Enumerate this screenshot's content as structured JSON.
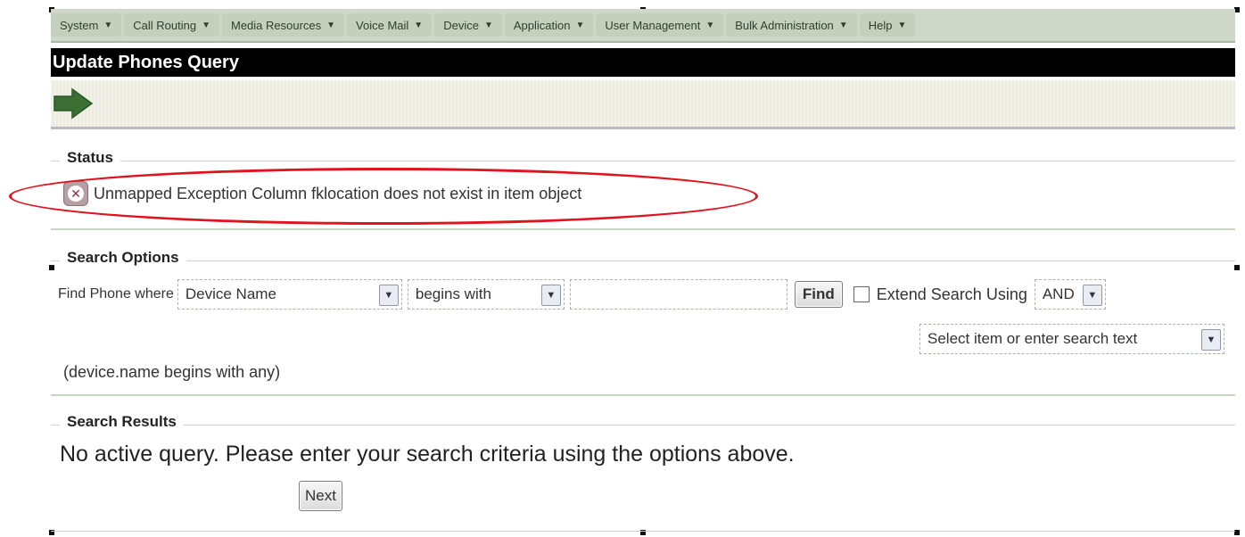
{
  "menu": [
    {
      "label": "System"
    },
    {
      "label": "Call Routing"
    },
    {
      "label": "Media Resources"
    },
    {
      "label": "Voice Mail"
    },
    {
      "label": "Device"
    },
    {
      "label": "Application"
    },
    {
      "label": "User Management"
    },
    {
      "label": "Bulk Administration"
    },
    {
      "label": "Help"
    }
  ],
  "page": {
    "title": "Update Phones Query"
  },
  "toolbar": {
    "icon": "arrow-right-icon",
    "color": "#3b6f34"
  },
  "status": {
    "legend": "Status",
    "message": "Unmapped Exception Column fklocation does not exist in item object",
    "highlight_color": "#e0131f"
  },
  "search_options": {
    "legend": "Search Options",
    "find_label": "Find Phone where",
    "field_select": "Device Name",
    "operator_select": "begins with",
    "search_value": "",
    "find_button": "Find",
    "extend_label": "Extend Search Using",
    "extend_checked": false,
    "logic_select": "AND",
    "item_select": "Select item or enter search text",
    "query_hint": "(device.name begins with any)"
  },
  "search_results": {
    "legend": "Search Results",
    "message": "No active query. Please enter your search criteria using the options above.",
    "next_button": "Next"
  }
}
